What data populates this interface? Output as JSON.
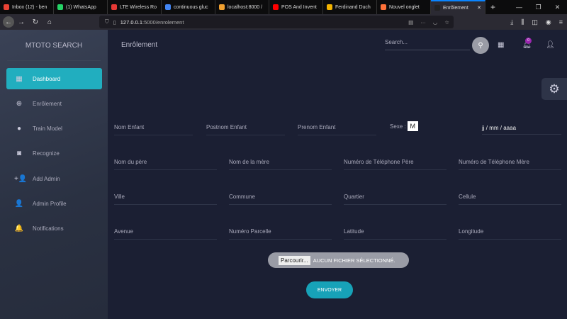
{
  "browser": {
    "tabs": [
      {
        "label": "Inbox (12) - ben",
        "color": "#ea4335"
      },
      {
        "label": "(1) WhatsApp",
        "color": "#25d366"
      },
      {
        "label": "LTE Wireless Ro",
        "color": "#e53935"
      },
      {
        "label": "continuous gluc",
        "color": "#4285f4"
      },
      {
        "label": "localhost:8000 /",
        "color": "#f0a030"
      },
      {
        "label": "POS And Invent",
        "color": "#ff0000"
      },
      {
        "label": "Ferdinand Duch",
        "color": "#f4b400"
      },
      {
        "label": "Nouvel onglet",
        "color": "#ff7139"
      },
      {
        "label": "Enrôlement",
        "color": "#222"
      }
    ],
    "url_host": "127.0.0.1",
    "url_path": ":5000/enrolement"
  },
  "sidebar": {
    "brand": "MTOTO SEARCH",
    "items": [
      {
        "label": "Dashboard",
        "icon": "▦"
      },
      {
        "label": "Enrôlement",
        "icon": "⊕"
      },
      {
        "label": "Train Model",
        "icon": "●"
      },
      {
        "label": "Recognize",
        "icon": "◙"
      },
      {
        "label": "Add Admin",
        "icon": "+👤"
      },
      {
        "label": "Admin Profile",
        "icon": "👤"
      },
      {
        "label": "Notifications",
        "icon": "🔔"
      }
    ]
  },
  "header": {
    "title": "Enrôlement",
    "search_placeholder": "Search...",
    "notification_count": "0"
  },
  "form": {
    "row1": [
      "Nom Enfant",
      "Postnom Enfant",
      "Prenom Enfant"
    ],
    "sexe_label": "Sexe :",
    "sexe_value": "M",
    "date_placeholder": "jj / mm / aaaa",
    "row2": [
      "Nom du père",
      "Nom de la mère",
      "Numéro de Téléphone Père",
      "Numéro de Téléphone Mère"
    ],
    "row3": [
      "Ville",
      "Commune",
      "Quartier",
      "Cellule"
    ],
    "row4": [
      "Avenue",
      "Numéro Parcelle",
      "Latitude",
      "Longitude"
    ],
    "browse_label": "Parcourir...",
    "no_file": "AUCUN FICHIER SÉLECTIONNÉ.",
    "submit": "ENVOYER"
  }
}
